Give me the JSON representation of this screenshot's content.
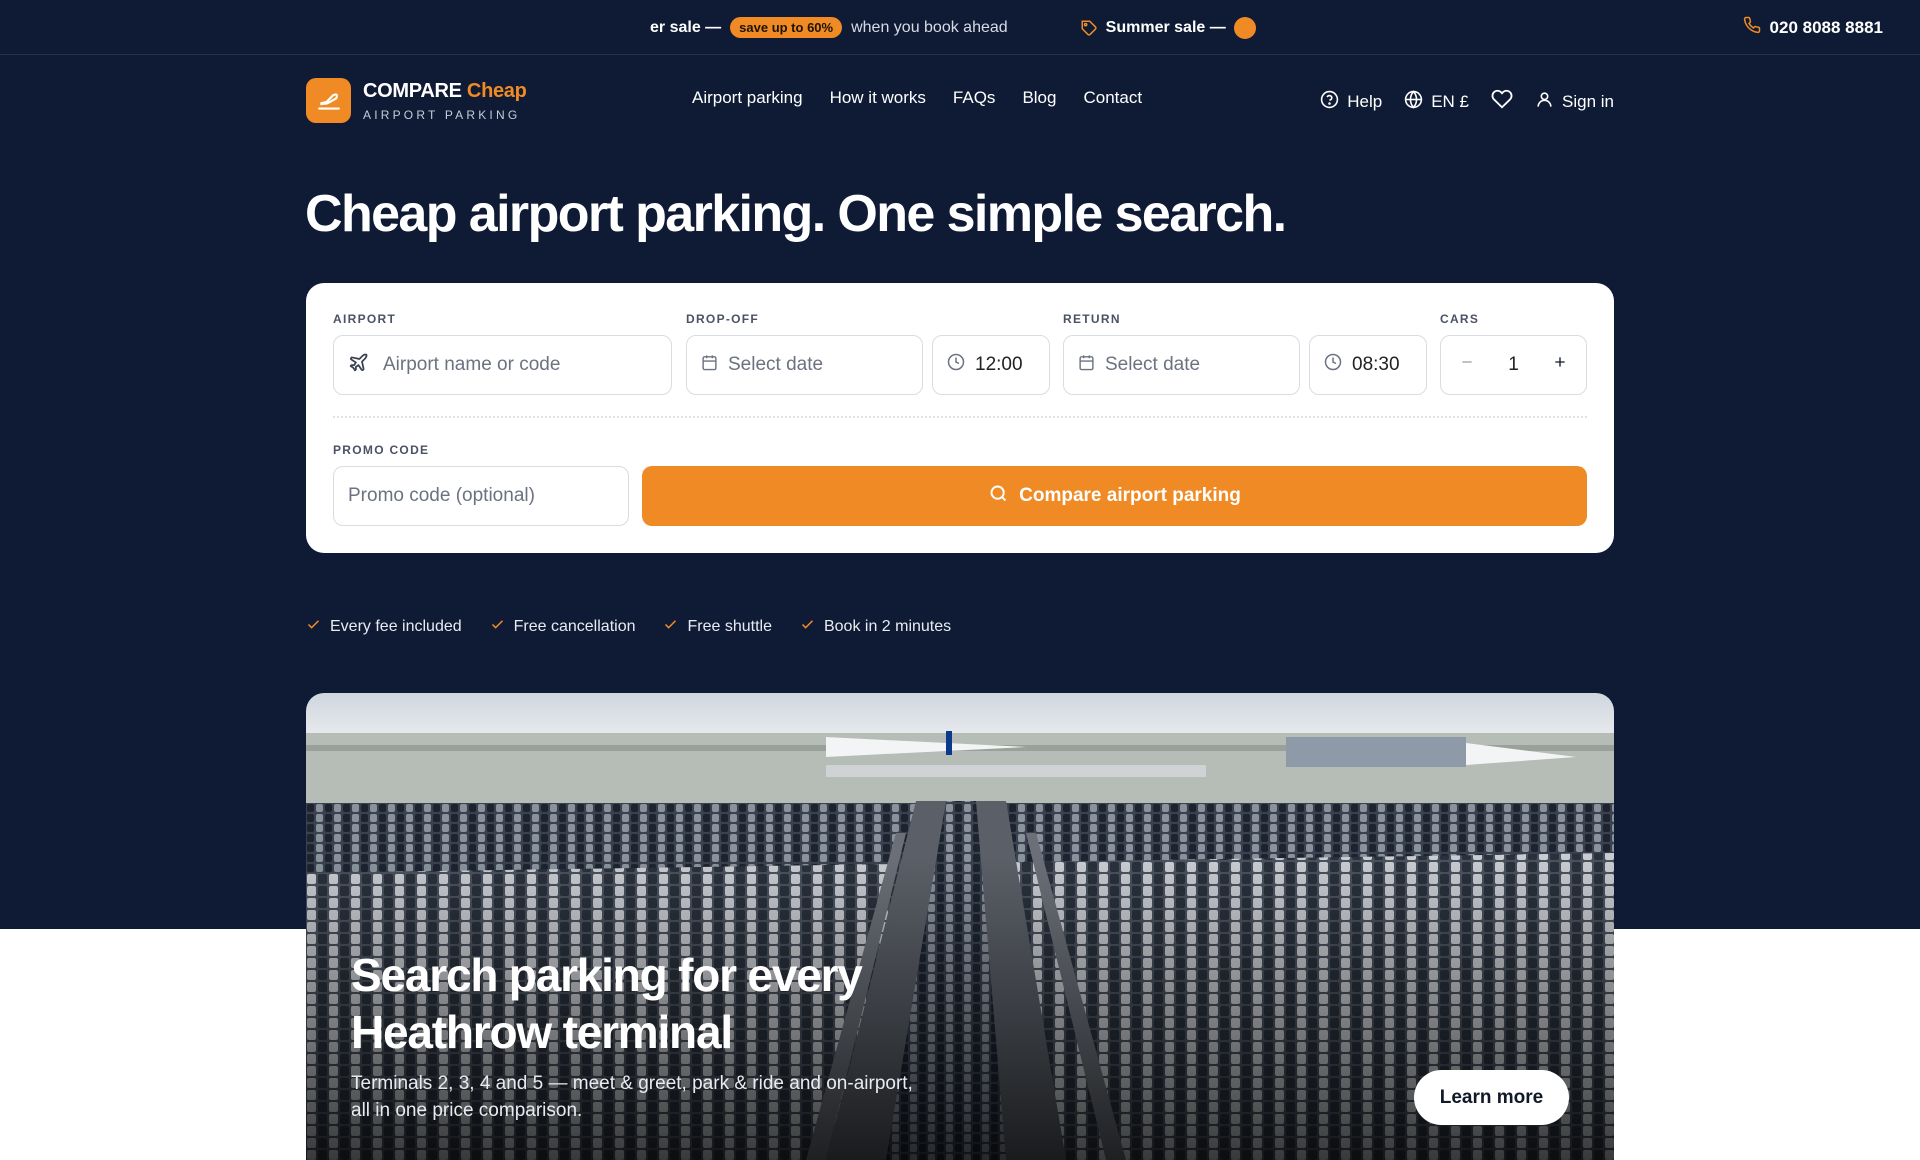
{
  "topbar": {
    "ticker_prefix": "er sale —",
    "ticker_pill": "save up to 60%",
    "ticker_after": "when you book ahead",
    "ticker_next": "Summer sale —",
    "phone": "020 8088 8881"
  },
  "brand": {
    "name_part1": "COMPARE",
    "name_part2": "Cheap",
    "tagline": "AIRPORT PARKING",
    "accent_color": "#f08a24",
    "navy_color": "#0f1b35"
  },
  "nav": {
    "items": [
      "Airport parking",
      "How it works",
      "FAQs",
      "Blog",
      "Contact"
    ]
  },
  "utility": {
    "help": "Help",
    "language": "EN £",
    "sign_in": "Sign in"
  },
  "hero": {
    "headline": "Cheap airport parking. One simple search."
  },
  "search": {
    "airport_label": "AIRPORT",
    "airport_placeholder": "Airport name or code",
    "dropoff_label": "DROP-OFF",
    "dropoff_date_placeholder": "Select date",
    "dropoff_time": "12:00",
    "return_label": "RETURN",
    "return_date_placeholder": "Select date",
    "return_time": "08:30",
    "cars_label": "CARS",
    "cars_value": "1",
    "promo_label": "PROMO CODE",
    "promo_placeholder": "Promo code (optional)",
    "submit_label": "Compare airport parking"
  },
  "benefits": [
    "Every fee included",
    "Free cancellation",
    "Free shuttle",
    "Book in 2 minutes"
  ],
  "feature": {
    "title_line1": "Search parking for every",
    "title_line2": "Heathrow terminal",
    "subtitle_line1": "Terminals 2, 3, 4 and 5 — meet & greet, park & ride and on-airport,",
    "subtitle_line2": "all in one price comparison.",
    "cta": "Learn more"
  }
}
